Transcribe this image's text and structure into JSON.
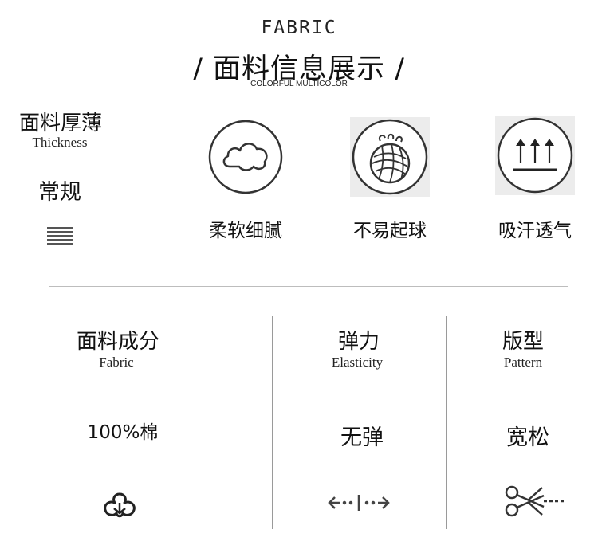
{
  "header": {
    "en_title": "FABRIC",
    "cn_title": "/ 面料信息展示 /",
    "subtitle": "COLORFUL MULTICOLOR"
  },
  "thickness": {
    "label_cn": "面料厚薄",
    "label_en": "Thickness",
    "value": "常规",
    "icon": "thickness-lines-icon"
  },
  "features": [
    {
      "label": "柔软细腻",
      "icon": "cloud-icon",
      "box_color": "#ffffff"
    },
    {
      "label": "不易起球",
      "icon": "yarn-ball-icon",
      "box_color": "#ececec"
    },
    {
      "label": "吸汗透气",
      "icon": "breathable-arrows-icon",
      "box_color": "#ececec"
    }
  ],
  "specs": [
    {
      "label_cn": "面料成分",
      "label_en": "Fabric",
      "value": "100%棉",
      "icon": "cotton-icon"
    },
    {
      "label_cn": "弹力",
      "label_en": "Elasticity",
      "value": "无弹",
      "icon": "stretch-arrows-icon"
    },
    {
      "label_cn": "版型",
      "label_en": "Pattern",
      "value": "宽松",
      "icon": "scissors-icon"
    }
  ]
}
